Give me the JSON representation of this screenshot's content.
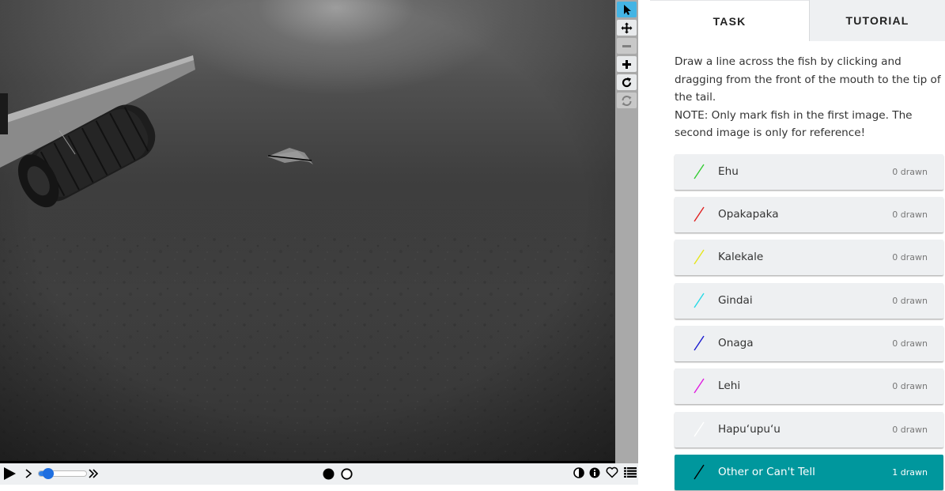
{
  "tabs": {
    "task": "TASK",
    "tutorial": "TUTORIAL"
  },
  "instructions": {
    "line1": "Draw a line across the fish by clicking and dragging from the front of the mouth to the tip of the tail.",
    "line2": "NOTE: Only mark fish in the first image. The second image is only for reference!"
  },
  "choices": [
    {
      "label": "Ehu",
      "count": "0 drawn",
      "color": "#33cc33"
    },
    {
      "label": "Opakapaka",
      "count": "0 drawn",
      "color": "#e02020"
    },
    {
      "label": "Kalekale",
      "count": "0 drawn",
      "color": "#e6e61a"
    },
    {
      "label": "Gindai",
      "count": "0 drawn",
      "color": "#26d9e6"
    },
    {
      "label": "Onaga",
      "count": "0 drawn",
      "color": "#1a1ad0"
    },
    {
      "label": "Lehi",
      "count": "0 drawn",
      "color": "#e01ae0"
    },
    {
      "label": "Hapu‘upu‘u",
      "count": "0 drawn",
      "color": "#ffffff"
    },
    {
      "label": "Other or Can't Tell",
      "count": "1 drawn",
      "color": "#000000"
    }
  ],
  "selected_choice": "Other or Can't Tell",
  "tools": [
    "pointer-icon",
    "pan-icon",
    "zoom-out-icon",
    "zoom-in-icon",
    "rotate-icon",
    "reset-icon"
  ],
  "controls": {
    "icons": [
      "play-icon",
      "step-icon",
      "fast-forward-icon",
      "frame-1-icon",
      "frame-2-icon",
      "invert-icon",
      "info-icon",
      "favorite-icon",
      "collections-icon"
    ],
    "playback_speed": 0.2
  },
  "colors": {
    "accent": "#00979d",
    "tool_active": "#44b4e4"
  }
}
